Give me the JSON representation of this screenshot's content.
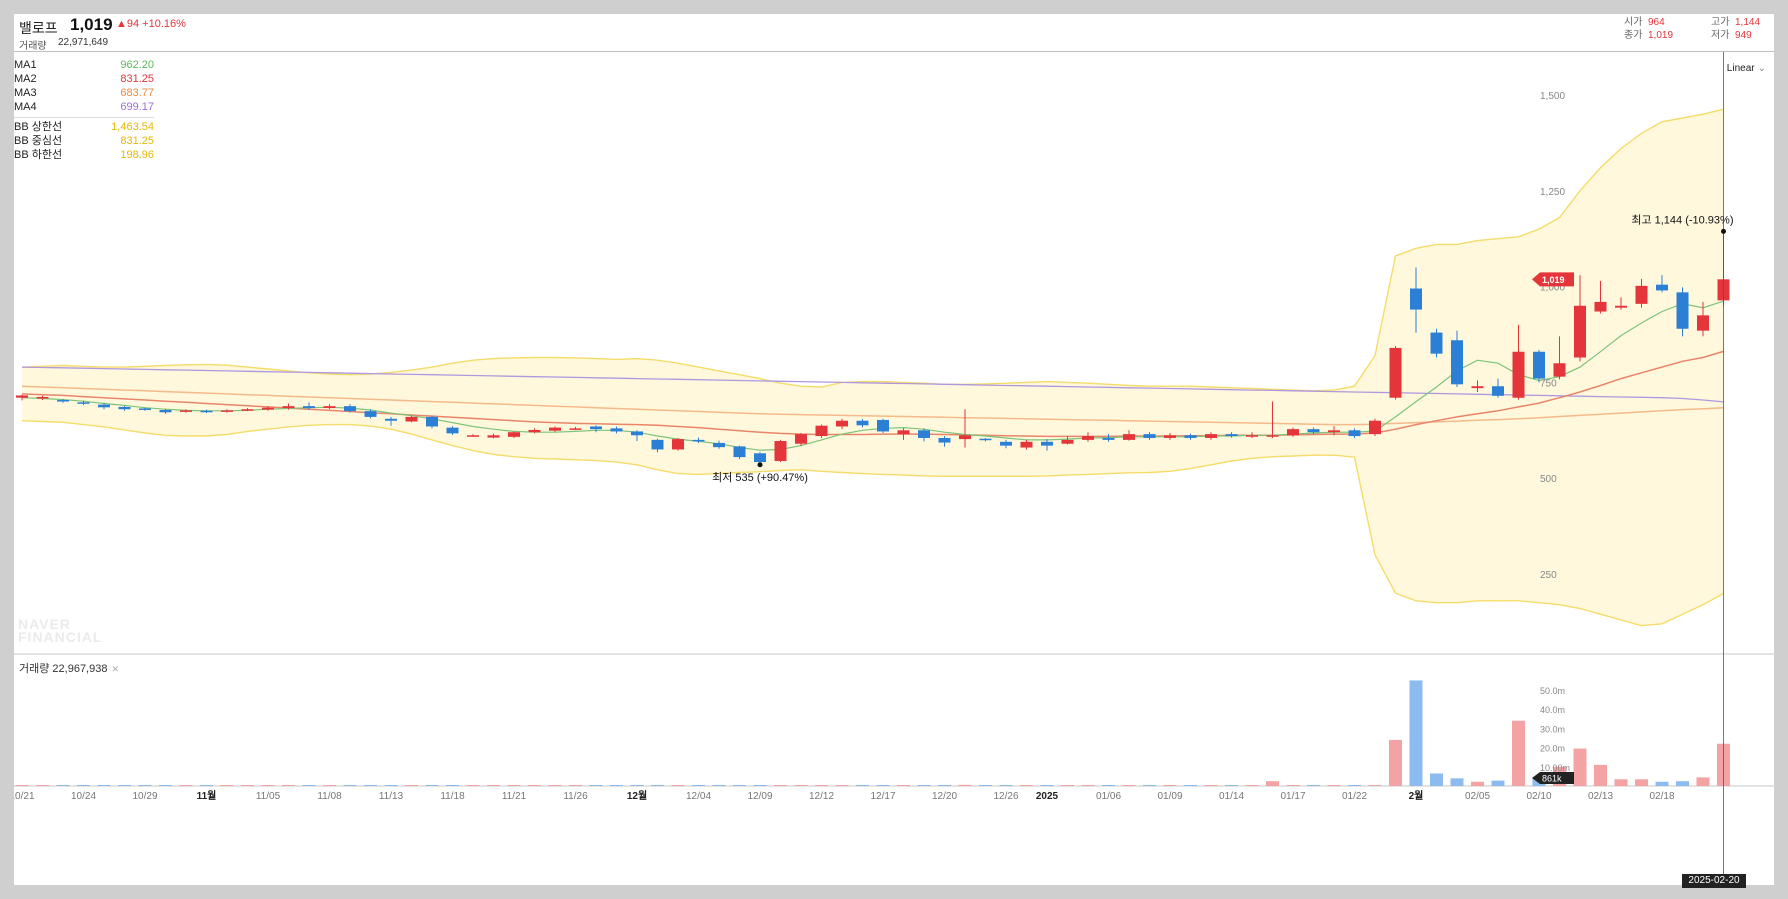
{
  "header": {
    "name": "밸로프",
    "price": "1,019",
    "change": "▲94 +10.16%",
    "volume_label": "거래량",
    "volume": "22,971,649",
    "ohlc": {
      "open_label": "시가",
      "open": "964",
      "high_label": "고가",
      "high": "1,144",
      "close_label": "종가",
      "close": "1,019",
      "low_label": "저가",
      "low": "949"
    }
  },
  "legend": {
    "ma": [
      {
        "name": "MA1",
        "value": "962.20",
        "color": "#5cb85c"
      },
      {
        "name": "MA2",
        "value": "831.25",
        "color": "#e4353b"
      },
      {
        "name": "MA3",
        "value": "683.77",
        "color": "#f0883e"
      },
      {
        "name": "MA4",
        "value": "699.17",
        "color": "#9b6fd4"
      }
    ],
    "bb": [
      {
        "name": "BB 상한선",
        "value": "1,463.54",
        "color": "#e6b800"
      },
      {
        "name": "BB 중심선",
        "value": "831.25",
        "color": "#e6b800"
      },
      {
        "name": "BB 하한선",
        "value": "198.96",
        "color": "#e6b800"
      }
    ]
  },
  "scale_mode": "Linear",
  "watermark": [
    "NAVER",
    "FINANCIAL"
  ],
  "volume_panel": {
    "title": "거래량 22,967,938",
    "current_badge": "861k"
  },
  "crosshair_date": "2025-02-20",
  "annotations": {
    "high": "최고 1,144 (-10.93%)",
    "low": "최저 535 (+90.47%)"
  },
  "colors": {
    "up": "#e4353b",
    "down": "#2b7fd4",
    "bb_fill": "#fff8dc",
    "bb_line": "#f5dc6a"
  },
  "chart_data": {
    "type": "candlestick",
    "y_ticks": [
      "1,500",
      "1,250",
      "1,000",
      "750",
      "500",
      "250"
    ],
    "y_tick_values": [
      1500,
      1250,
      1000,
      750,
      500,
      250
    ],
    "volume_ticks": [
      "50.0m",
      "40.0m",
      "30.0m",
      "20.0m",
      "10.00m"
    ],
    "volume_tick_values": [
      50,
      40,
      30,
      20,
      10
    ],
    "x_labels": [
      {
        "label": "10/21",
        "i": 0
      },
      {
        "label": "10/24",
        "i": 3
      },
      {
        "label": "10/29",
        "i": 6
      },
      {
        "label": "11월",
        "i": 9,
        "bold": true
      },
      {
        "label": "11/05",
        "i": 12
      },
      {
        "label": "11/08",
        "i": 15
      },
      {
        "label": "11/13",
        "i": 18
      },
      {
        "label": "11/18",
        "i": 21
      },
      {
        "label": "11/21",
        "i": 24
      },
      {
        "label": "11/26",
        "i": 27
      },
      {
        "label": "12월",
        "i": 30,
        "bold": true
      },
      {
        "label": "12/04",
        "i": 33
      },
      {
        "label": "12/09",
        "i": 36
      },
      {
        "label": "12/12",
        "i": 39
      },
      {
        "label": "12/17",
        "i": 42
      },
      {
        "label": "12/20",
        "i": 45
      },
      {
        "label": "12/26",
        "i": 48
      },
      {
        "label": "2025",
        "i": 50,
        "bold": true
      },
      {
        "label": "01/06",
        "i": 53
      },
      {
        "label": "01/09",
        "i": 56
      },
      {
        "label": "01/14",
        "i": 59
      },
      {
        "label": "01/17",
        "i": 62
      },
      {
        "label": "01/22",
        "i": 65
      },
      {
        "label": "2월",
        "i": 68,
        "bold": true
      },
      {
        "label": "02/05",
        "i": 71
      },
      {
        "label": "02/10",
        "i": 74
      },
      {
        "label": "02/13",
        "i": 77
      },
      {
        "label": "02/18",
        "i": 80
      }
    ],
    "candles": [
      [
        710,
        716,
        703,
        718
      ],
      [
        708,
        712,
        704,
        715
      ],
      [
        704,
        700,
        697,
        707
      ],
      [
        698,
        695,
        691,
        702
      ],
      [
        692,
        685,
        680,
        696
      ],
      [
        686,
        680,
        676,
        689
      ],
      [
        682,
        679,
        676,
        684
      ],
      [
        678,
        672,
        668,
        681
      ],
      [
        674,
        677,
        671,
        680
      ],
      [
        676,
        673,
        670,
        679
      ],
      [
        674,
        677,
        671,
        680
      ],
      [
        677,
        680,
        675,
        683
      ],
      [
        679,
        684,
        676,
        688
      ],
      [
        683,
        688,
        679,
        695
      ],
      [
        688,
        683,
        678,
        698
      ],
      [
        683,
        688,
        680,
        693
      ],
      [
        688,
        675,
        671,
        693
      ],
      [
        675,
        660,
        656,
        680
      ],
      [
        655,
        650,
        637,
        660
      ],
      [
        648,
        660,
        646,
        664
      ],
      [
        660,
        635,
        630,
        663
      ],
      [
        632,
        617,
        613,
        636
      ],
      [
        612,
        612,
        608,
        615
      ],
      [
        606,
        612,
        604,
        616
      ],
      [
        608,
        620,
        605,
        622
      ],
      [
        620,
        626,
        617,
        630
      ],
      [
        624,
        632,
        620,
        635
      ],
      [
        630,
        630,
        626,
        634
      ],
      [
        635,
        628,
        620,
        638
      ],
      [
        630,
        622,
        617,
        635
      ],
      [
        622,
        612,
        597,
        625
      ],
      [
        600,
        575,
        568,
        603
      ],
      [
        575,
        602,
        572,
        605
      ],
      [
        600,
        598,
        592,
        606
      ],
      [
        592,
        581,
        577,
        598
      ],
      [
        583,
        555,
        550,
        585
      ],
      [
        565,
        542,
        535,
        568
      ],
      [
        545,
        597,
        542,
        600
      ],
      [
        590,
        615,
        584,
        618
      ],
      [
        610,
        637,
        605,
        640
      ],
      [
        635,
        650,
        628,
        655
      ],
      [
        650,
        638,
        633,
        654
      ],
      [
        652,
        622,
        618,
        655
      ],
      [
        615,
        625,
        600,
        630
      ],
      [
        625,
        605,
        596,
        630
      ],
      [
        605,
        593,
        582,
        610
      ],
      [
        602,
        612,
        580,
        680
      ],
      [
        603,
        601,
        596,
        605
      ],
      [
        595,
        585,
        578,
        600
      ],
      [
        580,
        595,
        575,
        600
      ],
      [
        595,
        585,
        572,
        602
      ],
      [
        590,
        600,
        588,
        610
      ],
      [
        600,
        610,
        595,
        620
      ],
      [
        605,
        600,
        595,
        615
      ],
      [
        600,
        615,
        598,
        625
      ],
      [
        615,
        605,
        600,
        620
      ],
      [
        605,
        612,
        600,
        618
      ],
      [
        612,
        605,
        600,
        616
      ],
      [
        605,
        615,
        600,
        620
      ],
      [
        615,
        610,
        606,
        620
      ],
      [
        610,
        612,
        605,
        620
      ],
      [
        612,
        612,
        605,
        700
      ],
      [
        612,
        628,
        608,
        632
      ],
      [
        628,
        620,
        614,
        632
      ],
      [
        620,
        625,
        612,
        636
      ],
      [
        625,
        610,
        605,
        630
      ],
      [
        615,
        650,
        610,
        655
      ],
      [
        710,
        840,
        705,
        845
      ],
      [
        995,
        940,
        880,
        1050
      ],
      [
        880,
        825,
        815,
        890
      ],
      [
        860,
        745,
        738,
        885
      ],
      [
        735,
        740,
        725,
        755
      ],
      [
        740,
        715,
        710,
        760
      ],
      [
        710,
        830,
        705,
        900
      ],
      [
        830,
        760,
        750,
        835
      ],
      [
        765,
        800,
        758,
        870
      ],
      [
        815,
        950,
        805,
        1030
      ],
      [
        935,
        960,
        930,
        1015
      ],
      [
        945,
        950,
        940,
        972
      ],
      [
        955,
        1002,
        945,
        1020
      ],
      [
        1005,
        990,
        985,
        1030
      ],
      [
        985,
        890,
        870,
        998
      ],
      [
        885,
        925,
        870,
        960
      ],
      [
        964,
        1019,
        949,
        1144
      ]
    ],
    "volumes": [
      0.2,
      0.15,
      0.1,
      0.12,
      0.1,
      0.1,
      0.08,
      0.1,
      0.1,
      0.1,
      0.1,
      0.1,
      0.12,
      0.15,
      0.12,
      0.1,
      0.12,
      0.15,
      0.2,
      0.15,
      0.2,
      0.15,
      0.1,
      0.1,
      0.15,
      0.12,
      0.12,
      0.1,
      0.1,
      0.1,
      0.15,
      0.2,
      0.18,
      0.1,
      0.12,
      0.2,
      0.25,
      0.35,
      0.3,
      0.4,
      0.3,
      0.25,
      0.3,
      0.15,
      0.2,
      0.15,
      0.6,
      0.1,
      0.1,
      0.15,
      0.1,
      0.12,
      0.1,
      0.1,
      0.12,
      0.1,
      0.1,
      0.1,
      0.12,
      0.1,
      0.15,
      2.5,
      0.5,
      0.3,
      0.4,
      0.3,
      0.4,
      24,
      55,
      6.5,
      4,
      2.2,
      2.8,
      34,
      4,
      10,
      19.5,
      11,
      3.5,
      3.5,
      2.2,
      2.5,
      4.5,
      22
    ],
    "ma1": [
      710,
      708,
      705,
      701,
      695,
      690,
      684,
      680,
      677,
      676,
      676,
      677,
      680,
      682,
      684,
      685,
      683,
      678,
      670,
      663,
      655,
      645,
      635,
      628,
      622,
      620,
      620,
      622,
      625,
      625,
      620,
      610,
      602,
      596,
      590,
      580,
      573,
      575,
      585,
      600,
      615,
      625,
      630,
      632,
      628,
      620,
      614,
      610,
      605,
      600,
      600,
      602,
      605,
      606,
      608,
      608,
      608,
      608,
      610,
      610,
      612,
      612,
      615,
      618,
      620,
      620,
      623,
      660,
      700,
      738,
      780,
      808,
      800,
      770,
      755,
      765,
      790,
      830,
      872,
      905,
      935,
      955,
      945,
      962
    ],
    "ma2": [
      720,
      718,
      716,
      713,
      710,
      707,
      704,
      701,
      698,
      695,
      692,
      689,
      686,
      683,
      680,
      677,
      674,
      671,
      668,
      665,
      662,
      659,
      656,
      653,
      650,
      647,
      645,
      643,
      642,
      641,
      640,
      638,
      635,
      632,
      628,
      624,
      620,
      617,
      615,
      614,
      614,
      614,
      615,
      615,
      615,
      614,
      613,
      612,
      611,
      610,
      609,
      609,
      609,
      609,
      610,
      610,
      610,
      611,
      611,
      612,
      612,
      612,
      613,
      614,
      615,
      615,
      618,
      628,
      640,
      650,
      660,
      668,
      676,
      686,
      696,
      710,
      725,
      742,
      760,
      775,
      790,
      805,
      815,
      831
    ],
    "ma3": [
      740,
      738,
      736,
      734,
      732,
      730,
      728,
      726,
      724,
      722,
      720,
      718,
      716,
      714,
      712,
      710,
      708,
      706,
      704,
      702,
      700,
      698,
      696,
      694,
      692,
      690,
      688,
      686,
      684,
      682,
      680,
      678,
      676,
      674,
      672,
      670,
      668,
      667,
      666,
      665,
      664,
      663,
      662,
      661,
      660,
      659,
      658,
      657,
      656,
      655,
      654,
      653,
      652,
      651,
      650,
      649,
      648,
      647,
      646,
      645,
      644,
      643,
      642,
      641,
      640,
      640,
      641,
      643,
      645,
      647,
      649,
      651,
      653,
      655,
      658,
      661,
      664,
      667,
      670,
      673,
      676,
      679,
      681,
      684
    ],
    "ma4": [
      790,
      789,
      788,
      787,
      786,
      785,
      784,
      783,
      782,
      781,
      780,
      779,
      778,
      777,
      776,
      775,
      774,
      773,
      772,
      771,
      770,
      769,
      768,
      767,
      766,
      765,
      764,
      763,
      762,
      761,
      760,
      759,
      758,
      757,
      756,
      755,
      754,
      753,
      752,
      751,
      750,
      749,
      748,
      747,
      746,
      745,
      744,
      743,
      742,
      741,
      740,
      739,
      738,
      737,
      736,
      735,
      734,
      733,
      732,
      731,
      730,
      729,
      728,
      727,
      726,
      725,
      724,
      723,
      722,
      721,
      720,
      719,
      718,
      717,
      716,
      715,
      714,
      713,
      712,
      711,
      710,
      708,
      704,
      699
    ],
    "bb_upper": [
      790,
      792,
      794,
      792,
      790,
      790,
      792,
      794,
      796,
      797,
      795,
      790,
      785,
      780,
      775,
      772,
      770,
      772,
      776,
      782,
      790,
      800,
      808,
      812,
      814,
      815,
      815,
      814,
      812,
      810,
      812,
      808,
      800,
      790,
      780,
      770,
      760,
      748,
      740,
      738,
      750,
      752,
      752,
      750,
      748,
      745,
      745,
      746,
      748,
      750,
      752,
      750,
      748,
      745,
      742,
      740,
      740,
      740,
      738,
      736,
      734,
      732,
      730,
      728,
      730,
      740,
      820,
      1080,
      1100,
      1110,
      1110,
      1120,
      1125,
      1130,
      1150,
      1180,
      1250,
      1310,
      1360,
      1400,
      1430,
      1440,
      1450,
      1463
    ],
    "bb_lower": [
      650,
      648,
      646,
      640,
      634,
      626,
      618,
      612,
      610,
      610,
      614,
      622,
      628,
      634,
      638,
      640,
      640,
      636,
      628,
      615,
      600,
      585,
      572,
      562,
      556,
      552,
      550,
      548,
      546,
      542,
      535,
      522,
      512,
      510,
      512,
      515,
      517,
      520,
      522,
      518,
      515,
      512,
      510,
      508,
      506,
      505,
      505,
      505,
      505,
      505,
      506,
      508,
      510,
      512,
      514,
      515,
      518,
      525,
      535,
      545,
      552,
      556,
      558,
      560,
      560,
      555,
      300,
      200,
      180,
      175,
      175,
      180,
      180,
      180,
      175,
      170,
      160,
      145,
      130,
      115,
      120,
      145,
      170,
      199
    ]
  }
}
